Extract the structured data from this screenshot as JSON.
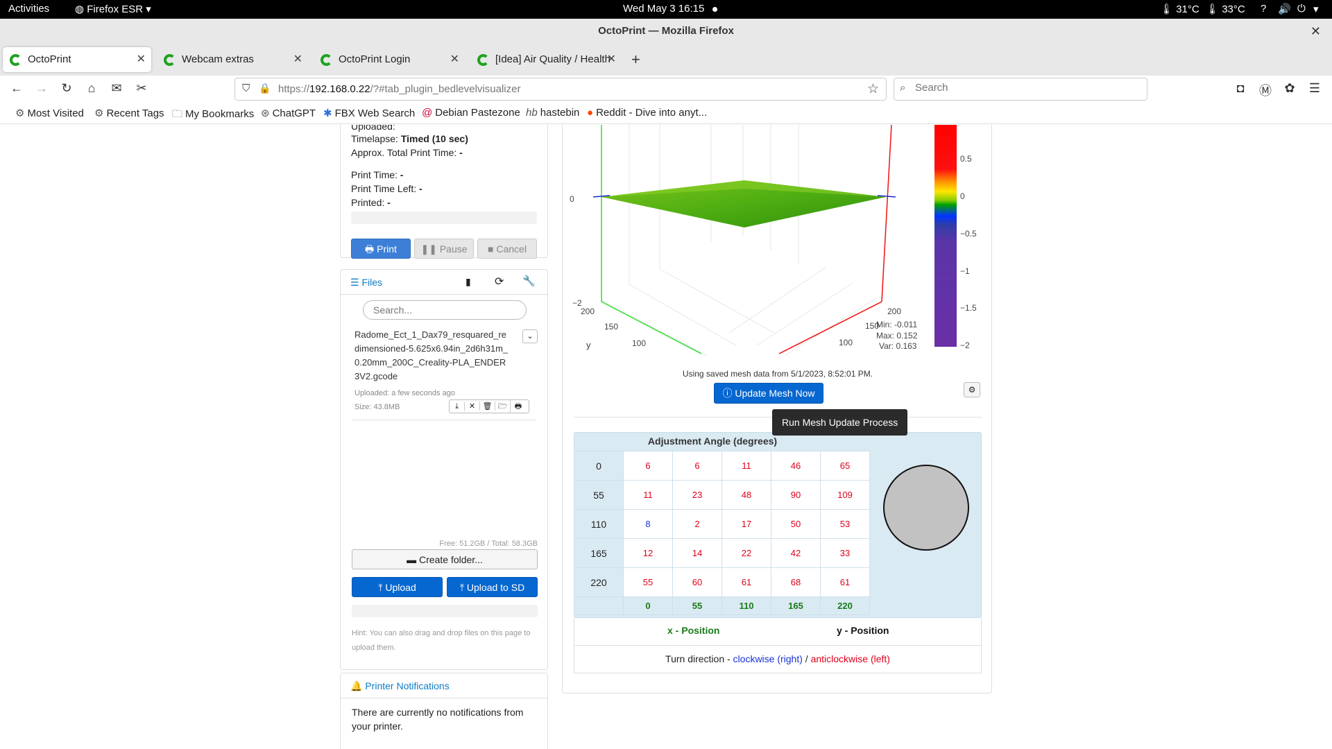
{
  "topbar": {
    "activities": "Activities",
    "app": "Firefox ESR",
    "clock": "Wed May 3  16:15",
    "temp1": "31°C",
    "temp2": "33°C"
  },
  "window": {
    "title": "OctoPrint — Mozilla Firefox"
  },
  "tabs": [
    {
      "label": "OctoPrint"
    },
    {
      "label": "Webcam extras"
    },
    {
      "label": "OctoPrint Login"
    },
    {
      "label": "[Idea] Air Quality / Health"
    }
  ],
  "urlbar": {
    "prefix": "https://",
    "host": "192.168.0.22",
    "path": "/?#tab_plugin_bedlevelvisualizer"
  },
  "search": {
    "placeholder": "Search"
  },
  "bookmarks": [
    {
      "label": "Most Visited"
    },
    {
      "label": "Recent Tags"
    },
    {
      "label": "My Bookmarks"
    },
    {
      "label": "ChatGPT"
    },
    {
      "label": "FBX Web Search"
    },
    {
      "label": "Debian Pastezone"
    },
    {
      "label": "hastebin"
    },
    {
      "label": "Reddit - Dive into anyt..."
    }
  ],
  "state": {
    "uploaded_label": "Uploaded:",
    "timelapse_label": "Timelapse:",
    "timelapse_value": "Timed (10 sec)",
    "approx_label": "Approx. Total Print Time:",
    "approx_value": "-",
    "print_time_label": "Print Time:",
    "print_time_value": "-",
    "time_left_label": "Print Time Left:",
    "time_left_value": "-",
    "printed_label": "Printed:",
    "printed_value": "-"
  },
  "controls": {
    "print": "Print",
    "pause": "Pause",
    "cancel": "Cancel"
  },
  "files": {
    "title": "Files",
    "search_placeholder": "Search...",
    "file_name": "Radome_Ect_1_Dax79_resquared_redimensioned-5.625x6.94in_2d6h31m_0.20mm_200C_Creality-PLA_ENDER3V2.gcode",
    "uploaded": "Uploaded: a few seconds ago",
    "size": "Size: 43.8MB",
    "storage": "Free: 51.2GB / Total: 58.3GB",
    "create_folder": "Create folder...",
    "upload": "Upload",
    "upload_sd": "Upload to SD",
    "hint": "Hint: You can also drag and drop files on this page to upload them."
  },
  "notifications": {
    "title": "Printer Notifications",
    "message": "There are currently no notifications from your printer."
  },
  "mesh": {
    "z_tick_top": "0",
    "z_tick_bottom": "−2",
    "y_axis_label": "y",
    "y_ticks": [
      "200",
      "150",
      "100"
    ],
    "x_ticks": [
      "200",
      "150",
      "100"
    ],
    "stats": {
      "min": "Min: -0.011",
      "max": "Max: 0.152",
      "var": "Var: 0.163"
    },
    "colorbar_ticks": [
      "0.5",
      "0",
      "−0.5",
      "−1",
      "−1.5",
      "−2"
    ],
    "saved_text": "Using saved mesh data from 5/1/2023, 8:52:01 PM.",
    "update_button": "Update Mesh Now",
    "tooltip": "Run Mesh Update Process"
  },
  "adjustment": {
    "title": "Adjustment Angle (degrees)",
    "rows": [
      {
        "y": "0",
        "values": [
          "6",
          "6",
          "11",
          "46",
          "65"
        ],
        "colors": [
          "red",
          "red",
          "red",
          "red",
          "red"
        ]
      },
      {
        "y": "55",
        "values": [
          "11",
          "23",
          "48",
          "90",
          "109"
        ],
        "colors": [
          "red",
          "red",
          "red",
          "red",
          "red"
        ]
      },
      {
        "y": "110",
        "values": [
          "8",
          "2",
          "17",
          "50",
          "53"
        ],
        "colors": [
          "blue",
          "red",
          "red",
          "red",
          "red"
        ]
      },
      {
        "y": "165",
        "values": [
          "12",
          "14",
          "22",
          "42",
          "33"
        ],
        "colors": [
          "red",
          "red",
          "red",
          "red",
          "red"
        ]
      },
      {
        "y": "220",
        "values": [
          "55",
          "60",
          "61",
          "68",
          "61"
        ],
        "colors": [
          "red",
          "red",
          "red",
          "red",
          "red"
        ]
      }
    ],
    "x_values": [
      "0",
      "55",
      "110",
      "165",
      "220"
    ],
    "x_label": "x - Position",
    "y_label": "y - Position",
    "turn_prefix": "Turn direction - ",
    "clockwise": "clockwise (right)",
    "separator": " / ",
    "anticlockwise": "anticlockwise (left)"
  }
}
